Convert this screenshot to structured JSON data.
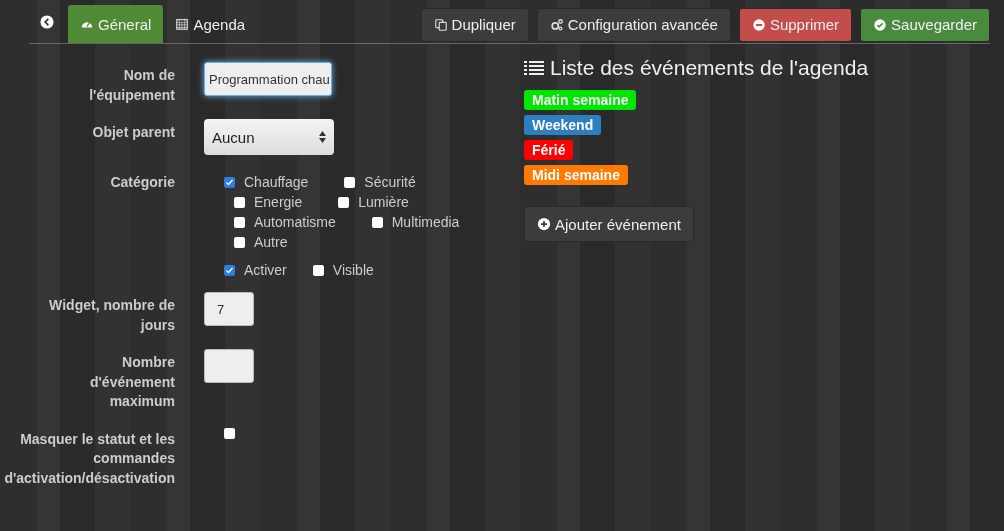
{
  "tabs": [
    {
      "label": "Géneral",
      "selected": true
    },
    {
      "label": "Agenda",
      "selected": false
    }
  ],
  "actions": [
    {
      "label": "Dupliquer",
      "kind": "default"
    },
    {
      "label": "Configuration avancée",
      "kind": "default"
    },
    {
      "label": "Supprimer",
      "kind": "danger"
    },
    {
      "label": "Sauvegarder",
      "kind": "success"
    }
  ],
  "form": {
    "name_label": "Nom de l'équipement",
    "name_value": "Programmation chau",
    "parent_label": "Objet parent",
    "parent_value": "Aucun",
    "category_label": "Catégorie",
    "categories": [
      {
        "label": "Chauffage",
        "checked": true
      },
      {
        "label": "Sécurité",
        "checked": false
      },
      {
        "label": "Energie",
        "checked": false
      },
      {
        "label": "Lumière",
        "checked": false
      },
      {
        "label": "Automatisme",
        "checked": false
      },
      {
        "label": "Multimedia",
        "checked": false
      },
      {
        "label": "Autre",
        "checked": false
      }
    ],
    "flags": [
      {
        "label": "Activer",
        "checked": true
      },
      {
        "label": "Visible",
        "checked": false
      }
    ],
    "days_label": "Widget, nombre de jours",
    "days_value": "7",
    "max_label": "Nombre d'événement maximum",
    "hide_label": "Masquer le statut et les commandes d'activation/désactivation",
    "hide_checked": false
  },
  "events": {
    "title": "Liste des événements de l'agenda",
    "items": [
      {
        "label": "Matin semaine",
        "color": "#00e600"
      },
      {
        "label": "Weekend",
        "color": "#2d80c0"
      },
      {
        "label": "Férié",
        "color": "#ff0000"
      },
      {
        "label": "Midi semaine",
        "color": "#ff7a00"
      }
    ],
    "add_button": "Ajouter événement"
  }
}
